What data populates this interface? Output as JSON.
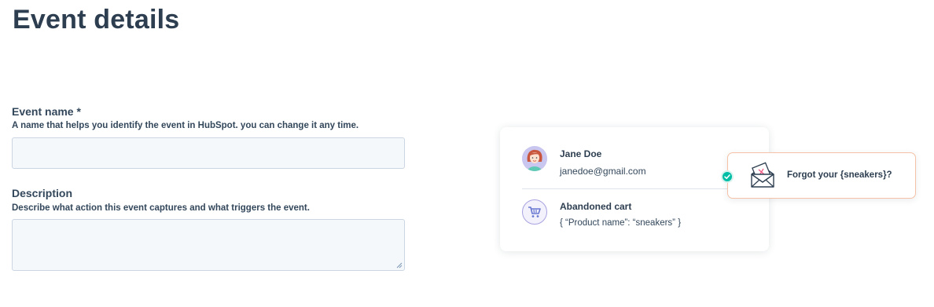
{
  "page": {
    "title": "Event details"
  },
  "form": {
    "event_name": {
      "label": "Event name *",
      "help": "A name that helps you identify the event in HubSpot. you can change it any time.",
      "value": ""
    },
    "description": {
      "label": "Description",
      "help": "Describe what action this event captures and what triggers the event.",
      "value": ""
    }
  },
  "preview": {
    "contact": {
      "name": "Jane Doe",
      "email": "janedoe@gmail.com",
      "icon": "avatar-woman"
    },
    "event": {
      "title": "Abandoned cart",
      "properties": "{ “Product name”: “sneakers” }",
      "icon": "shopping-cart-icon"
    },
    "email": {
      "subject": "Forgot your {sneakers}?",
      "icon": "open-envelope-icon"
    },
    "status_icon": "check-icon"
  },
  "colors": {
    "heading": "#2d3e50",
    "input_bg": "#f5f8fa",
    "input_border": "#cbd6e2",
    "check": "#00bda5",
    "email_card_border": "#f5c2a7",
    "cart_icon": "#6a78d1"
  }
}
